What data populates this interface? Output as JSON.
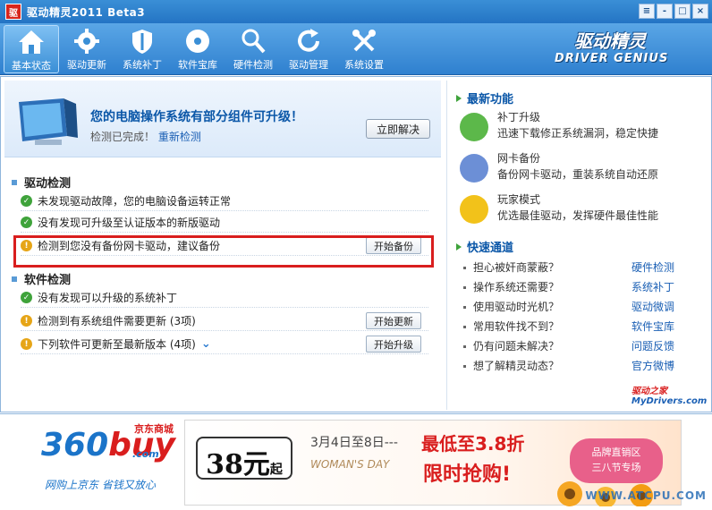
{
  "window": {
    "logo": "驱",
    "title": "驱动精灵2011 Beta3",
    "controls": [
      "≡",
      "-",
      "□",
      "×"
    ]
  },
  "toolbar": {
    "items": [
      {
        "label": "基本状态",
        "icon": "home-icon",
        "active": true
      },
      {
        "label": "驱动更新",
        "icon": "gear-icon",
        "active": false
      },
      {
        "label": "系统补丁",
        "icon": "shield-icon",
        "active": false
      },
      {
        "label": "软件宝库",
        "icon": "disc-icon",
        "active": false
      },
      {
        "label": "硬件检测",
        "icon": "magnifier-icon",
        "active": false
      },
      {
        "label": "驱动管理",
        "icon": "refresh-icon",
        "active": false
      },
      {
        "label": "系统设置",
        "icon": "tools-icon",
        "active": false
      }
    ],
    "brand_top": "驱动精灵",
    "brand_bottom": "DRIVER  GENIUS"
  },
  "notice": {
    "title": "您的电脑操作系统有部分组件可升级！",
    "sub_prefix": "检测已完成！",
    "sub_link": "重新检测",
    "button": "立即解决"
  },
  "driver_section": {
    "heading": "驱动检测",
    "rows": [
      {
        "status": "ok",
        "text": "未发现驱动故障，您的电脑设备运转正常",
        "action": ""
      },
      {
        "status": "ok",
        "text": "没有发现可升级至认证版本的新版驱动",
        "action": ""
      },
      {
        "status": "warn",
        "text": "检测到您没有备份网卡驱动，建议备份",
        "action": "开始备份"
      }
    ]
  },
  "software_section": {
    "heading": "软件检测",
    "rows": [
      {
        "status": "ok",
        "text": "没有发现可以升级的系统补丁",
        "action": ""
      },
      {
        "status": "warn",
        "text": "检测到有系统组件需要更新 (3项)",
        "action": "开始更新"
      },
      {
        "status": "warn",
        "text": "下列软件可更新至最新版本 (4项)",
        "action": "开始升级",
        "more": "⌄"
      }
    ]
  },
  "latest": {
    "heading": "最新功能",
    "features": [
      {
        "title": "补丁升级",
        "desc": "迅速下载修正系统漏洞，稳定快捷",
        "icon": "patch-icon",
        "color": "#5cb84a"
      },
      {
        "title": "网卡备份",
        "desc": "备份网卡驱动，重装系统自动还原",
        "icon": "network-gear-icon",
        "color": "#6c8fd6"
      },
      {
        "title": "玩家模式",
        "desc": "优选最佳驱动，发挥硬件最佳性能",
        "icon": "smiley-icon",
        "color": "#f2c21a"
      }
    ]
  },
  "quick": {
    "heading": "快速通道",
    "rows": [
      {
        "q": "担心被奸商蒙蔽？",
        "link": "硬件检测"
      },
      {
        "q": "操作系统还需要？",
        "link": "系统补丁"
      },
      {
        "q": "使用驱动时光机？",
        "link": "驱动微调"
      },
      {
        "q": "常用软件找不到？",
        "link": "软件宝库"
      },
      {
        "q": "仍有问题未解决？",
        "link": "问题反馈"
      },
      {
        "q": "想了解精灵动态？",
        "link": "官方微博"
      }
    ],
    "partner_top": "驱动之家",
    "partner_bottom": "MyDrivers.com"
  },
  "banner": {
    "jd_top": "京东商城",
    "jd_main_a": "360",
    "jd_main_b": "buy",
    "jd_dot": ".com",
    "jd_tagline": "网购上京东 省钱又放心",
    "price": "38元",
    "price_suffix": "起",
    "date": "3月4日至8日---",
    "lowest": "最低至3.8折",
    "womens": "WOMAN'S DAY",
    "limited": "限时抢购!",
    "pink_line1": "品牌直销区",
    "pink_line2": "三八节专场",
    "watermark": "WWW.ATCPU.COM"
  }
}
